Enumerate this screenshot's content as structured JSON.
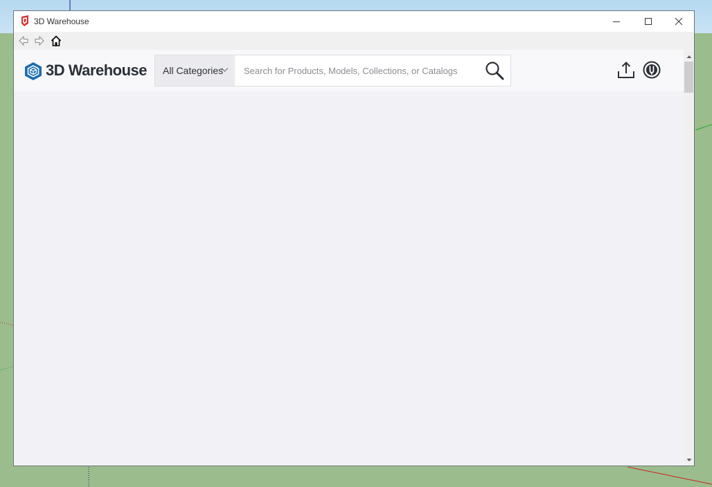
{
  "window": {
    "title": "3D Warehouse"
  },
  "nav": {
    "back": "back-arrow-icon",
    "forward": "forward-arrow-icon",
    "home": "home-icon"
  },
  "header": {
    "logo_text": "3D Warehouse",
    "category_label": "All Categories",
    "search_placeholder": "Search for Products, Models, Collections, or Catalogs",
    "search_value": ""
  },
  "colors": {
    "brand": "#1a6bb0",
    "viewport_ground": "#9bbd8d",
    "content_bg": "#f2f2f6"
  }
}
